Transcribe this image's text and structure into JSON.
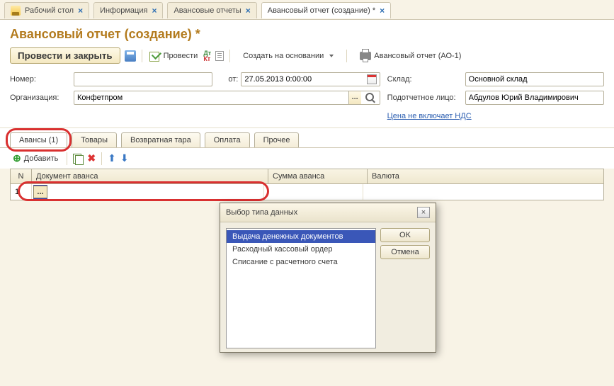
{
  "topTabs": {
    "desktop": "Рабочий стол",
    "info": "Информация",
    "reports": "Авансовые отчеты",
    "active": "Авансовый отчет (создание) *"
  },
  "header": {
    "title": "Авансовый отчет (создание) *"
  },
  "toolbar": {
    "postClose": "Провести и закрыть",
    "post": "Провести",
    "createBased": "Создать на основании",
    "printAO": "Авансовый отчет (АО-1)"
  },
  "fields": {
    "numberLabel": "Номер:",
    "numberValue": "",
    "dateLabel": "от:",
    "dateValue": "27.05.2013 0:00:00",
    "warehouseLabel": "Склад:",
    "warehouseValue": "Основной склад",
    "orgLabel": "Организация:",
    "orgValue": "Конфетпром",
    "personLabel": "Подотчетное лицо:",
    "personValue": "Абдулов Юрий Владимирович",
    "priceLink": "Цена не включает НДС"
  },
  "midTabs": {
    "advances": "Авансы (1)",
    "goods": "Товары",
    "tara": "Возвратная тара",
    "payment": "Оплата",
    "other": "Прочее"
  },
  "subbar": {
    "add": "Добавить"
  },
  "grid": {
    "colN": "N",
    "colDoc": "Документ аванса",
    "colSum": "Сумма аванса",
    "colVal": "Валюта",
    "rowN": "1"
  },
  "modal": {
    "title": "Выбор типа данных",
    "item1": "Выдача денежных документов",
    "item2": "Расходный кассовый ордер",
    "item3": "Списание с расчетного счета",
    "ok": "OK",
    "cancel": "Отмена"
  }
}
